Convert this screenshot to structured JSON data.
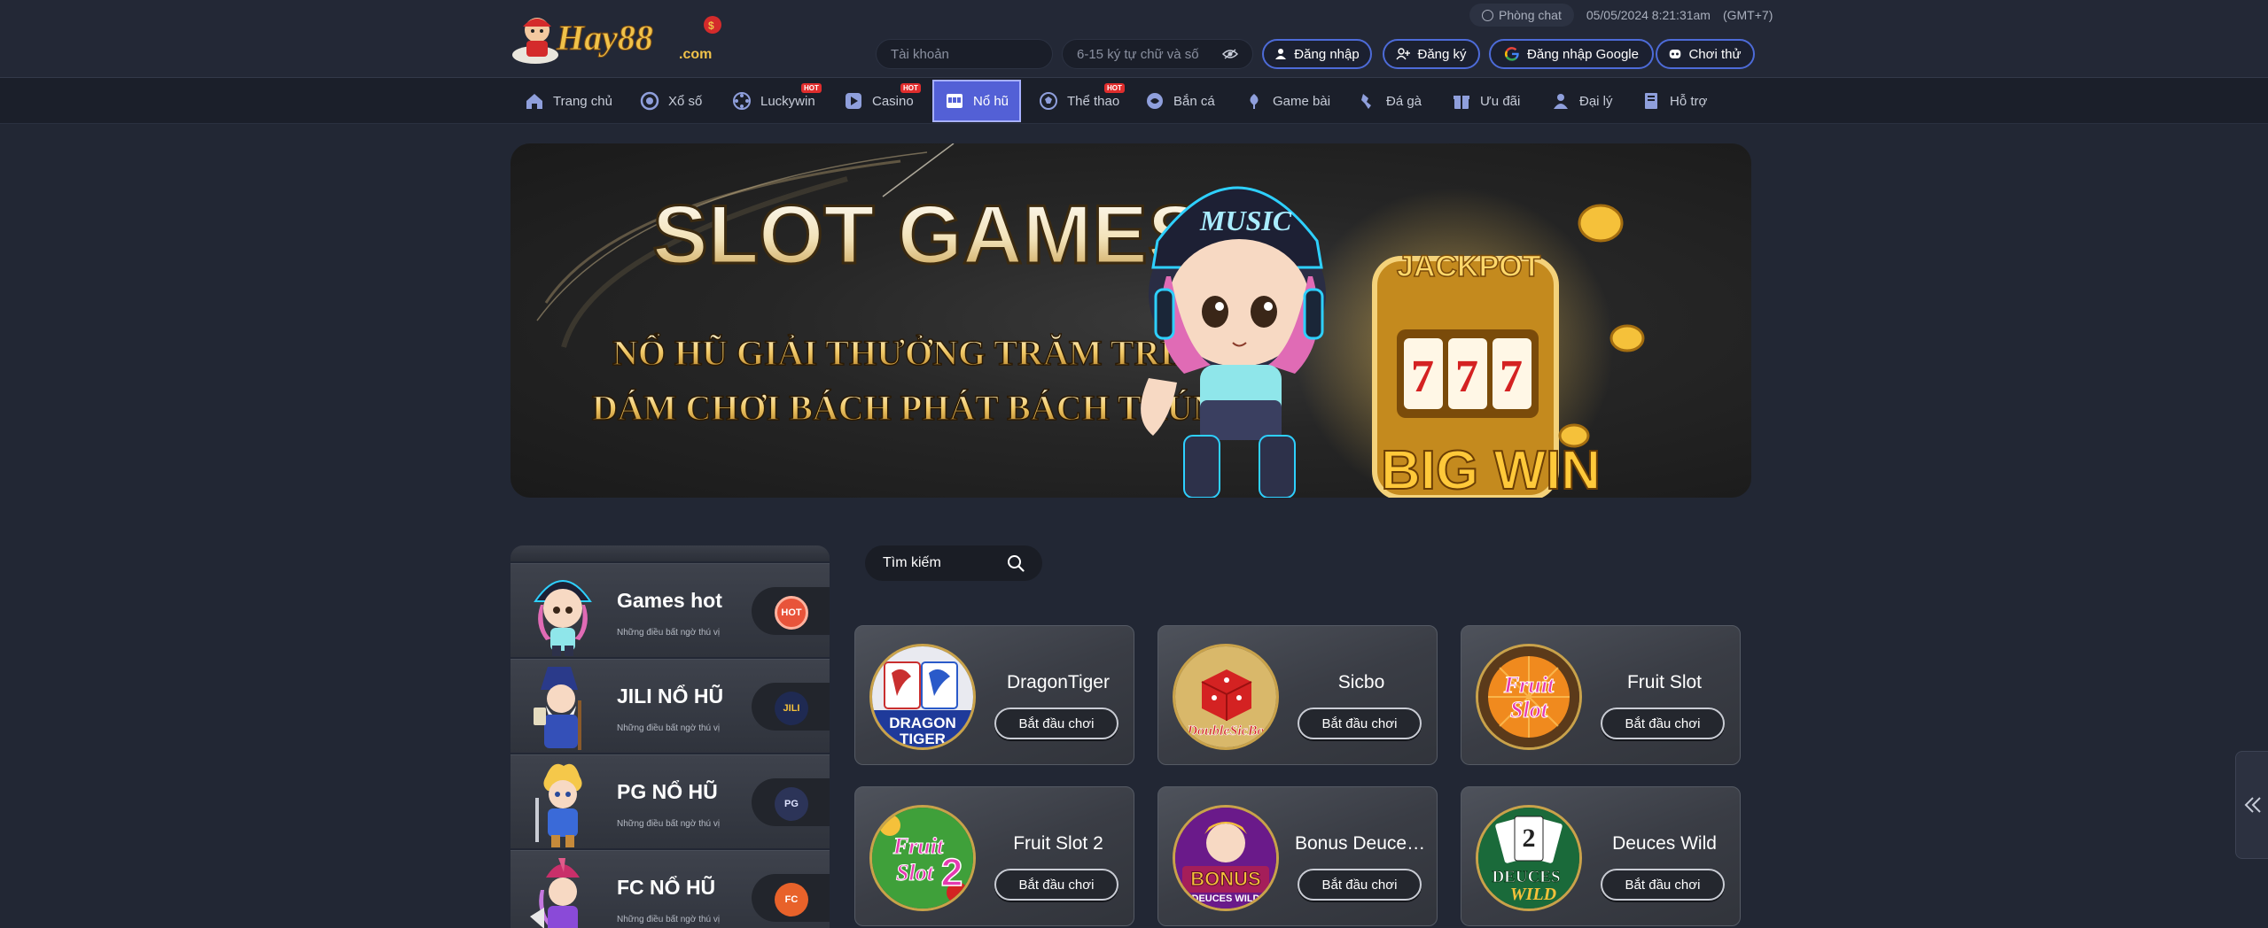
{
  "header": {
    "chat_label": "Phòng chat",
    "datetime": "05/05/2024 8:21:31am",
    "timezone": "(GMT+7)",
    "username_placeholder": "Tài khoản",
    "password_placeholder": "6-15 ký tự chữ và số",
    "login_label": "Đăng nhập",
    "register_label": "Đăng ký",
    "google_label": "Đăng nhập Google",
    "trial_label": "Chơi thử",
    "logo_text": "Hay88.com"
  },
  "nav": {
    "items": [
      {
        "label": "Trang chủ",
        "icon": "home-icon",
        "hot": false
      },
      {
        "label": "Xổ số",
        "icon": "lottery-icon",
        "hot": false
      },
      {
        "label": "Luckywin",
        "icon": "luckywin-icon",
        "hot": true
      },
      {
        "label": "Casino",
        "icon": "casino-icon",
        "hot": true
      },
      {
        "label": "Nổ hũ",
        "icon": "slot-icon",
        "hot": false,
        "active": true
      },
      {
        "label": "Thể thao",
        "icon": "sports-icon",
        "hot": true
      },
      {
        "label": "Bắn cá",
        "icon": "fish-icon",
        "hot": false
      },
      {
        "label": "Game bài",
        "icon": "cards-icon",
        "hot": false
      },
      {
        "label": "Đá gà",
        "icon": "cockfight-icon",
        "hot": false
      },
      {
        "label": "Ưu đãi",
        "icon": "gift-icon",
        "hot": false
      },
      {
        "label": "Đại lý",
        "icon": "agent-icon",
        "hot": false
      },
      {
        "label": "Hỗ trợ",
        "icon": "support-icon",
        "hot": false
      }
    ],
    "hot_label": "HOT"
  },
  "banner": {
    "title": "SLOT GAMES",
    "line1": "NỔ HŨ GIẢI THƯỞNG TRĂM TRIỆU",
    "line2": "DÁM CHƠI BÁCH PHÁT BÁCH TRÚNG",
    "jackpot": "JACKPOT",
    "bigwin": "BIG WIN",
    "cap_text": "MUSIC",
    "sevens": "7"
  },
  "sidebar": {
    "subtitle": "Những điều bất ngờ thú vị",
    "items": [
      {
        "title": "Games hot",
        "badge": "HOT",
        "badge_color": "#e8543a"
      },
      {
        "title": "JILI NỔ HŨ",
        "badge": "JILI",
        "badge_color": "#1f2a52"
      },
      {
        "title": "PG NỔ HŨ",
        "badge": "PG",
        "badge_color": "#2c3458"
      },
      {
        "title": "FC NỔ HŨ",
        "badge": "FC",
        "badge_color": "#e8622a"
      }
    ]
  },
  "search": {
    "label": "Tìm kiếm"
  },
  "games": {
    "play_label": "Bắt đầu chơi",
    "items": [
      {
        "name": "DragonTiger",
        "thumb_text": "DRAGON TIGER"
      },
      {
        "name": "Sicbo",
        "thumb_text": "DoubleSicBo"
      },
      {
        "name": "Fruit Slot",
        "thumb_text": "Fruit Slot"
      },
      {
        "name": "Fruit Slot 2",
        "thumb_text": "Fruit Slot 2"
      },
      {
        "name": "Bonus Deuces Wild",
        "thumb_text": "BONUS DEUCES WILD"
      },
      {
        "name": "Deuces Wild",
        "thumb_text": "DEUCES WILD"
      }
    ]
  }
}
